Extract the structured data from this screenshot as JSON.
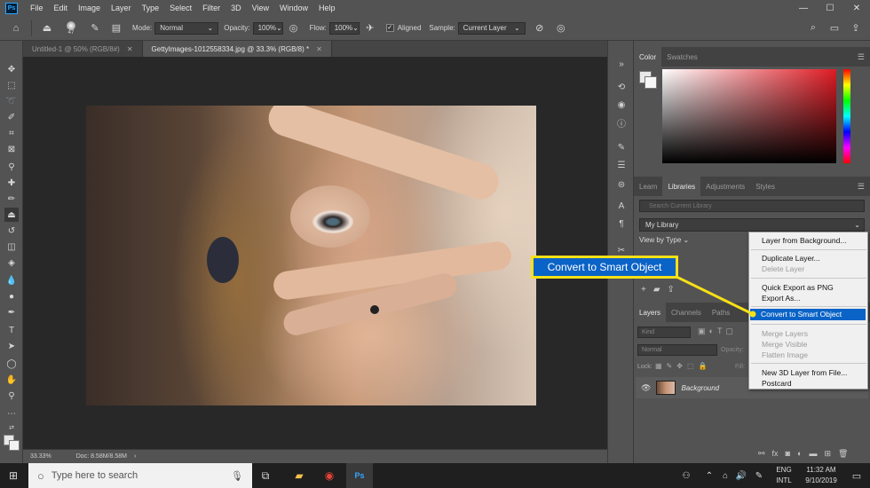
{
  "menubar": {
    "logo": "Ps",
    "items": [
      "File",
      "Edit",
      "Image",
      "Layer",
      "Type",
      "Select",
      "Filter",
      "3D",
      "View",
      "Window",
      "Help"
    ],
    "window_controls": [
      "—",
      "☐",
      "✕"
    ]
  },
  "options_bar": {
    "brush_size": "47",
    "mode_label": "Mode:",
    "mode_value": "Normal",
    "opacity_label": "Opacity:",
    "opacity_value": "100%",
    "flow_label": "Flow:",
    "flow_value": "100%",
    "aligned_label": "Aligned",
    "sample_label": "Sample:",
    "sample_value": "Current Layer"
  },
  "doc_tabs": [
    {
      "label": "Untitled-1 @ 50% (RGB/8#)",
      "close": "✕"
    },
    {
      "label": "GettyImages-1012558334.jpg @ 33.3% (RGB/8) *",
      "close": "✕"
    }
  ],
  "status_bar": {
    "zoom": "33.33%",
    "doc": "Doc: 8.58M/8.58M",
    "arrow": "›"
  },
  "color_panel": {
    "tabs": [
      "Color",
      "Swatches"
    ],
    "accent": "#e01b24"
  },
  "libraries_panel": {
    "tabs": [
      "Learn",
      "Libraries",
      "Adjustments",
      "Styles"
    ],
    "search_placeholder": "Search Current Library",
    "library_name": "My Library",
    "view_by": "View by Type"
  },
  "layers_panel": {
    "tabs": [
      "Layers",
      "Channels",
      "Paths"
    ],
    "kind": "Kind",
    "blend": "Normal",
    "opacity_label": "Opacity:",
    "lock_label": "Lock:",
    "fill_label": "Fill:",
    "layer_name": "Background"
  },
  "context_menu": {
    "items": [
      {
        "label": "Layer from Background...",
        "disabled": false
      },
      {
        "label": "Duplicate Layer...",
        "disabled": false
      },
      {
        "label": "Delete Layer",
        "disabled": true
      },
      {
        "label": "Quick Export as PNG",
        "disabled": false
      },
      {
        "label": "Export As...",
        "disabled": false
      },
      {
        "label": "Convert to Smart Object",
        "disabled": false,
        "highlighted": true
      },
      {
        "label": "Merge Layers",
        "disabled": true
      },
      {
        "label": "Merge Visible",
        "disabled": true
      },
      {
        "label": "Flatten Image",
        "disabled": true
      },
      {
        "label": "New 3D Layer from File...",
        "disabled": false
      },
      {
        "label": "Postcard",
        "disabled": false
      }
    ]
  },
  "callout": {
    "text": "Convert to Smart Object",
    "border_color": "#f6e017",
    "fill_color": "#0a63c6"
  },
  "taskbar": {
    "search_placeholder": "Type here to search",
    "lang_top": "ENG",
    "lang_bottom": "INTL",
    "time": "11:32 AM",
    "date": "9/10/2019"
  }
}
